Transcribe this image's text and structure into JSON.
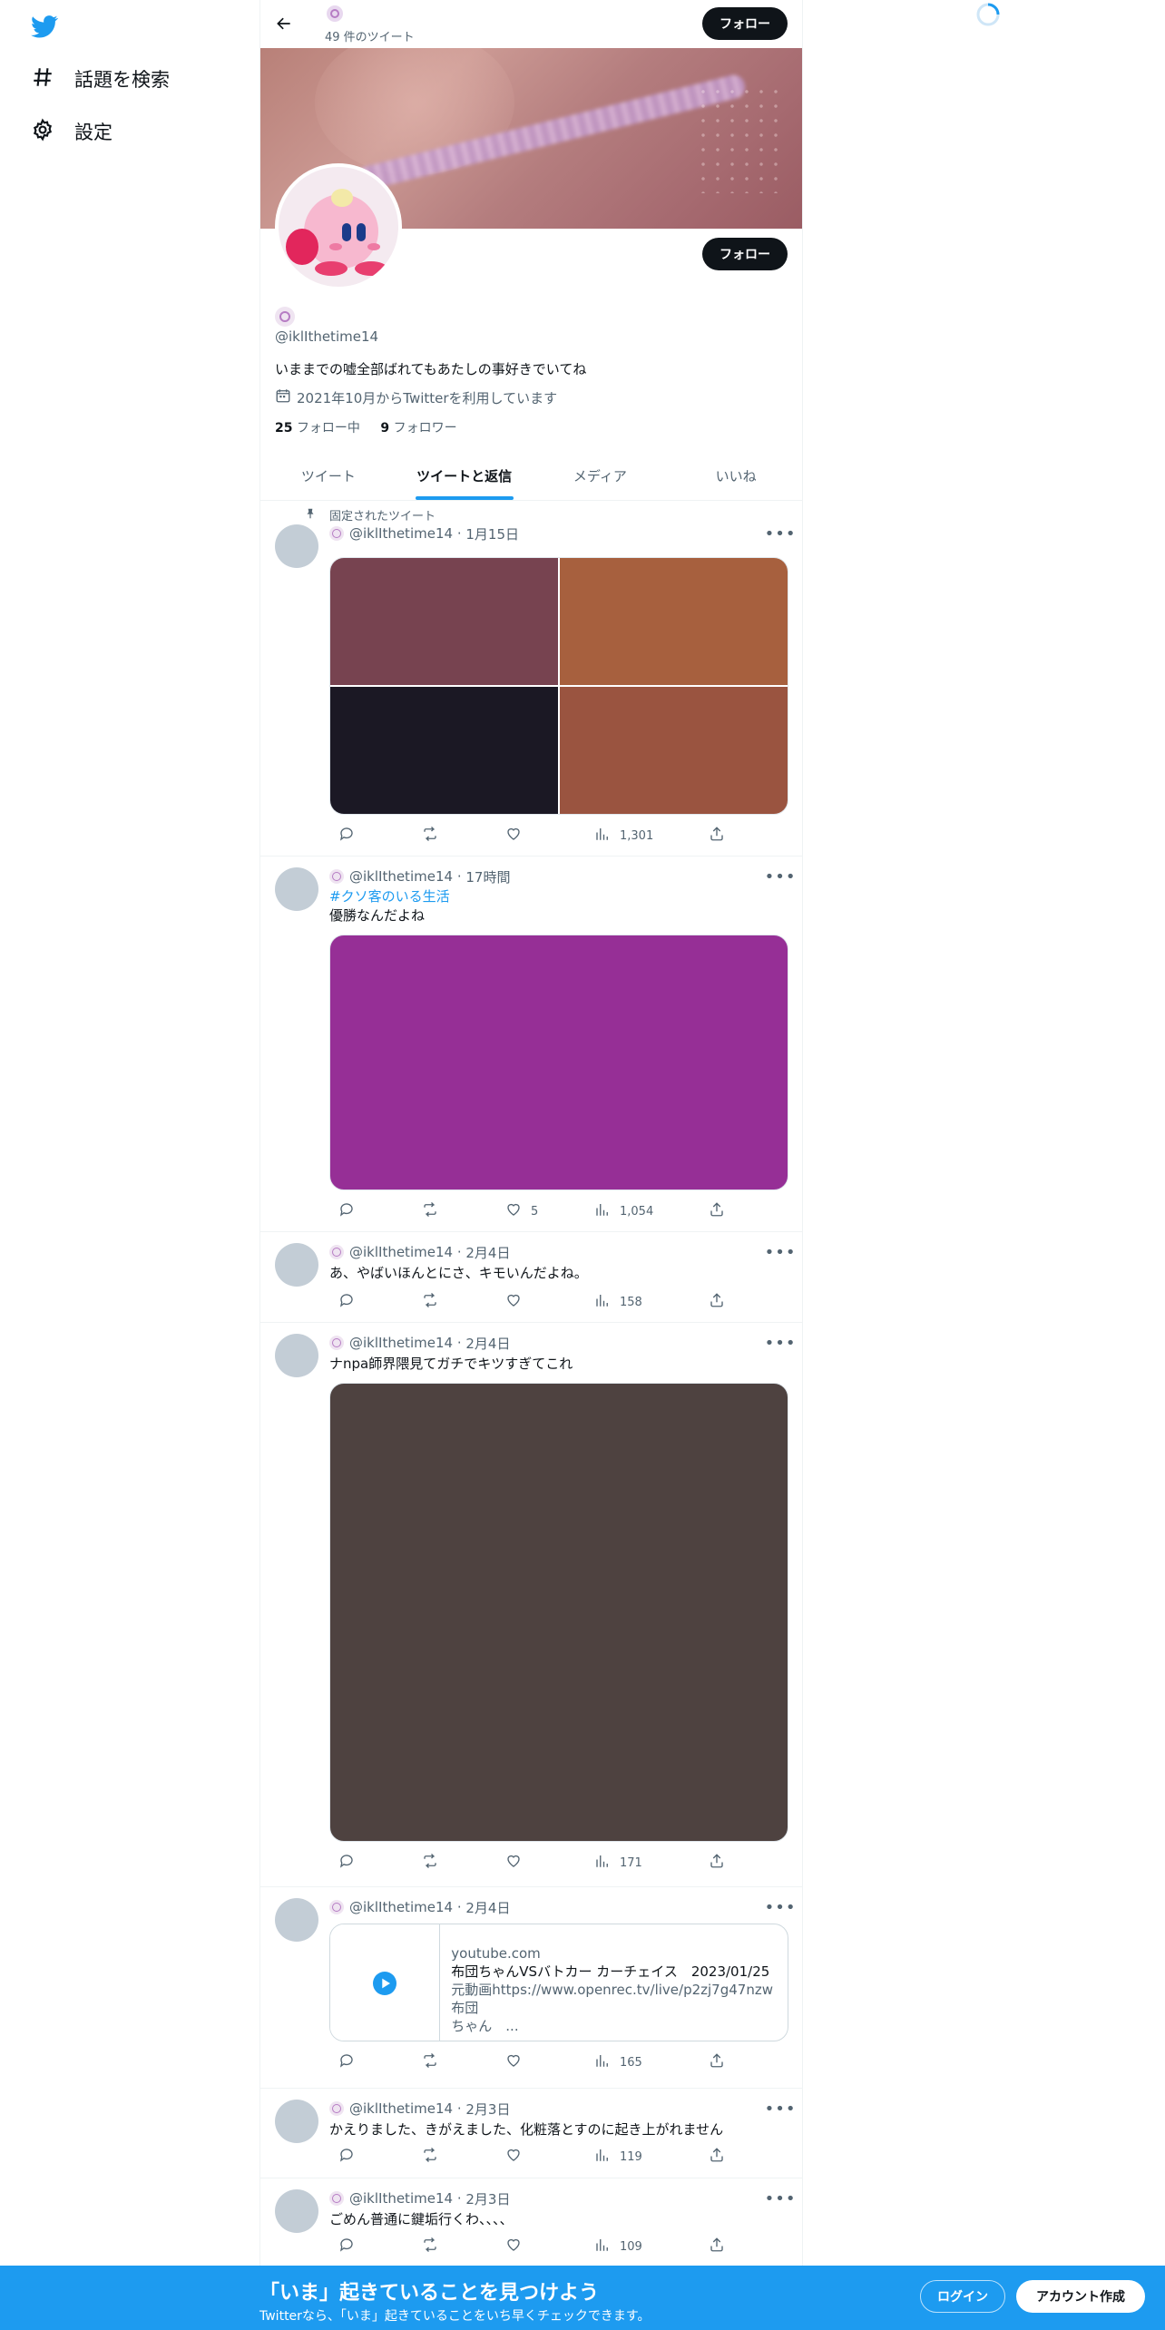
{
  "nav": {
    "explore_label": "話題を検索",
    "settings_label": "設定"
  },
  "topbar": {
    "tweet_count": "49 件のツイート",
    "follow_label": "フォロー"
  },
  "profile": {
    "follow_label": "フォロー",
    "handle": "@iklIthetime14",
    "bio": "いままでの嘘全部ばれてもあたしの事好きでいてね",
    "joined": "2021年10月からTwitterを利用しています",
    "following_count": "25",
    "following_label": "フォロー中",
    "followers_count": "9",
    "followers_label": "フォロワー"
  },
  "tabs": [
    {
      "label": "ツイート",
      "active": false
    },
    {
      "label": "ツイートと返信",
      "active": true
    },
    {
      "label": "メディア",
      "active": false
    },
    {
      "label": "いいね",
      "active": false
    }
  ],
  "tweets": [
    {
      "pinned_label": "固定されたツイート",
      "handle": "@iklIthetime14",
      "time": "1月15日",
      "image_colors": [
        "#774350",
        "#a7603e",
        "#1b1824",
        "#9a5440"
      ],
      "likes": "",
      "views": "1,301"
    },
    {
      "handle": "@iklIthetime14",
      "time": "17時間",
      "hashtag": "#クソ客のいる生活",
      "text": "優勝なんだよね",
      "image_color": "#962f96",
      "likes": "5",
      "views": "1,054"
    },
    {
      "handle": "@iklIthetime14",
      "time": "2月4日",
      "text": "あ、やばいほんとにさ、キモいんだよね。",
      "likes": "",
      "views": "158"
    },
    {
      "handle": "@iklIthetime14",
      "time": "2月4日",
      "text": "ナnpa師界隈見てガチでキツすぎてこれ",
      "image_color": "#4e4240",
      "likes": "",
      "views": "171"
    },
    {
      "handle": "@iklIthetime14",
      "time": "2月4日",
      "card": {
        "domain": "youtube.com",
        "title": "布団ちゃんVSバトカー カーチェイス　2023/01/25",
        "desc_line1": "元動画https://www.openrec.tv/live/p2zj7g47nzw布団",
        "desc_line2": "ちゃん　..."
      },
      "likes": "",
      "views": "165"
    },
    {
      "handle": "@iklIthetime14",
      "time": "2月3日",
      "text": "かえりました、きがえました、化粧落とすのに起き上がれません",
      "likes": "",
      "views": "119"
    },
    {
      "handle": "@iklIthetime14",
      "time": "2月3日",
      "text": "ごめん普通に鍵垢行くわ、、、、",
      "likes": "",
      "views": "109"
    }
  ],
  "bottom_bar": {
    "title": "「いま」起きていることを見つけよう",
    "subtitle": "Twitterなら、「いま」起きていることをいち早くチェックできます。",
    "login_label": "ログイン",
    "signup_label": "アカウント作成"
  },
  "colors": {
    "accent": "#1d9bf0",
    "text": "#0f1419",
    "secondary": "#536471"
  }
}
